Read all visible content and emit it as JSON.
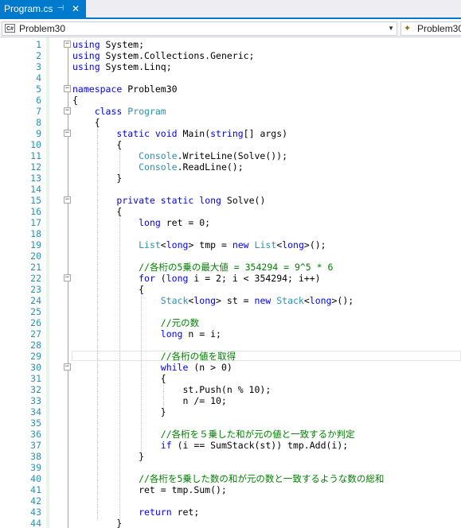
{
  "tab": {
    "title": "Program.cs",
    "pin_glyph": "⊣",
    "close_glyph": "✕"
  },
  "nav": {
    "left_badge": "C#",
    "left_label": "Problem30",
    "right_label": "Problem30"
  },
  "lines": [
    [
      {
        "t": "using",
        "c": "kw"
      },
      {
        "t": " System;"
      }
    ],
    [
      {
        "t": "using",
        "c": "kw"
      },
      {
        "t": " System.Collections.Generic;"
      }
    ],
    [
      {
        "t": "using",
        "c": "kw"
      },
      {
        "t": " System.Linq;"
      }
    ],
    [],
    [
      {
        "t": "namespace",
        "c": "kw"
      },
      {
        "t": " Problem30"
      }
    ],
    [
      {
        "t": "{"
      }
    ],
    [
      {
        "t": "    "
      },
      {
        "t": "class",
        "c": "kw"
      },
      {
        "t": " "
      },
      {
        "t": "Program",
        "c": "ty"
      }
    ],
    [
      {
        "t": "    {"
      }
    ],
    [
      {
        "t": "        "
      },
      {
        "t": "static",
        "c": "kw"
      },
      {
        "t": " "
      },
      {
        "t": "void",
        "c": "kw"
      },
      {
        "t": " Main("
      },
      {
        "t": "string",
        "c": "kw"
      },
      {
        "t": "[] args)"
      }
    ],
    [
      {
        "t": "        {"
      }
    ],
    [
      {
        "t": "            "
      },
      {
        "t": "Console",
        "c": "ty"
      },
      {
        "t": ".WriteLine(Solve());"
      }
    ],
    [
      {
        "t": "            "
      },
      {
        "t": "Console",
        "c": "ty"
      },
      {
        "t": ".ReadLine();"
      }
    ],
    [
      {
        "t": "        }"
      }
    ],
    [],
    [
      {
        "t": "        "
      },
      {
        "t": "private",
        "c": "kw"
      },
      {
        "t": " "
      },
      {
        "t": "static",
        "c": "kw"
      },
      {
        "t": " "
      },
      {
        "t": "long",
        "c": "kw"
      },
      {
        "t": " Solve()"
      }
    ],
    [
      {
        "t": "        {"
      }
    ],
    [
      {
        "t": "            "
      },
      {
        "t": "long",
        "c": "kw"
      },
      {
        "t": " ret = 0;"
      }
    ],
    [],
    [
      {
        "t": "            "
      },
      {
        "t": "List",
        "c": "ty"
      },
      {
        "t": "<"
      },
      {
        "t": "long",
        "c": "kw"
      },
      {
        "t": "> tmp = "
      },
      {
        "t": "new",
        "c": "kw"
      },
      {
        "t": " "
      },
      {
        "t": "List",
        "c": "ty"
      },
      {
        "t": "<"
      },
      {
        "t": "long",
        "c": "kw"
      },
      {
        "t": ">();"
      }
    ],
    [],
    [
      {
        "t": "            "
      },
      {
        "t": "//各桁の5乗の最大値 = 354294 = 9^5 * 6",
        "c": "cm"
      }
    ],
    [
      {
        "t": "            "
      },
      {
        "t": "for",
        "c": "kw"
      },
      {
        "t": " ("
      },
      {
        "t": "long",
        "c": "kw"
      },
      {
        "t": " i = 2; i < 354294; i++)"
      }
    ],
    [
      {
        "t": "            {"
      }
    ],
    [
      {
        "t": "                "
      },
      {
        "t": "Stack",
        "c": "ty"
      },
      {
        "t": "<"
      },
      {
        "t": "long",
        "c": "kw"
      },
      {
        "t": "> st = "
      },
      {
        "t": "new",
        "c": "kw"
      },
      {
        "t": " "
      },
      {
        "t": "Stack",
        "c": "ty"
      },
      {
        "t": "<"
      },
      {
        "t": "long",
        "c": "kw"
      },
      {
        "t": ">();"
      }
    ],
    [],
    [
      {
        "t": "                "
      },
      {
        "t": "//元の数",
        "c": "cm"
      }
    ],
    [
      {
        "t": "                "
      },
      {
        "t": "long",
        "c": "kw"
      },
      {
        "t": " n = i;"
      }
    ],
    [],
    [
      {
        "t": "                "
      },
      {
        "t": "//各桁の値を取得",
        "c": "cm"
      }
    ],
    [
      {
        "t": "                "
      },
      {
        "t": "while",
        "c": "kw"
      },
      {
        "t": " (n > 0)"
      }
    ],
    [
      {
        "t": "                {"
      }
    ],
    [
      {
        "t": "                    st.Push(n % 10);"
      }
    ],
    [
      {
        "t": "                    n /= 10;"
      }
    ],
    [
      {
        "t": "                }"
      }
    ],
    [],
    [
      {
        "t": "                "
      },
      {
        "t": "//各桁を５乗した和が元の値と一致するか判定",
        "c": "cm"
      }
    ],
    [
      {
        "t": "                "
      },
      {
        "t": "if",
        "c": "kw"
      },
      {
        "t": " (i == SumStack(st)) tmp.Add(i);"
      }
    ],
    [
      {
        "t": "            }"
      }
    ],
    [],
    [
      {
        "t": "            "
      },
      {
        "t": "//各桁を5乗した数の和が元の数と一致するような数の総和",
        "c": "cm"
      }
    ],
    [
      {
        "t": "            ret = tmp.Sum();"
      }
    ],
    [],
    [
      {
        "t": "            "
      },
      {
        "t": "return",
        "c": "kw"
      },
      {
        "t": " ret;"
      }
    ],
    [
      {
        "t": "        }"
      }
    ]
  ],
  "colors": {
    "keyword": "#0000ff",
    "type": "#2b91af",
    "comment": "#008000",
    "line_number": "#2b91af",
    "tab_active": "#007acc"
  }
}
